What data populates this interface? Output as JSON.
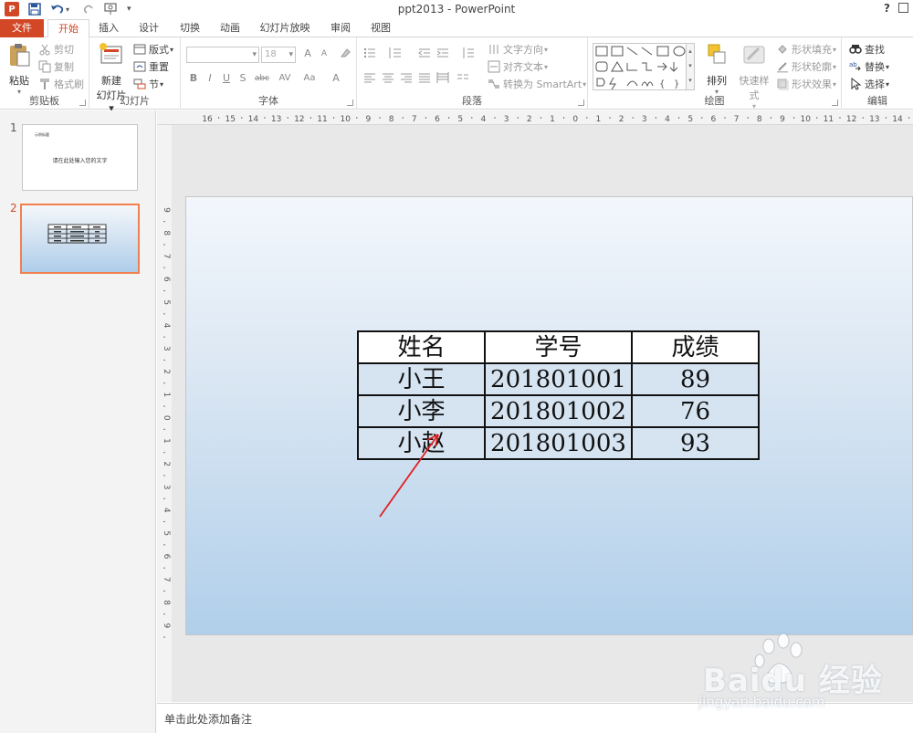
{
  "window": {
    "title": "ppt2013 - PowerPoint",
    "app_logo": "P",
    "help": "?"
  },
  "quick_access": [
    "save-icon",
    "undo-icon",
    "redo-icon",
    "slideshow-icon",
    "customize-icon"
  ],
  "tabs": [
    {
      "label": "文件",
      "kind": "file"
    },
    {
      "label": "开始",
      "kind": "active"
    },
    {
      "label": "插入"
    },
    {
      "label": "设计"
    },
    {
      "label": "切换"
    },
    {
      "label": "动画"
    },
    {
      "label": "幻灯片放映"
    },
    {
      "label": "审阅"
    },
    {
      "label": "视图"
    }
  ],
  "ribbon": {
    "clipboard": {
      "label": "剪贴板",
      "paste": "粘贴",
      "cut": "剪切",
      "copy": "复制",
      "format_painter": "格式刷"
    },
    "slides": {
      "label": "幻灯片",
      "new_slide_1": "新建",
      "new_slide_2": "幻灯片",
      "layout": "版式",
      "reset": "重置",
      "section": "节"
    },
    "font": {
      "label": "字体",
      "font_name": "",
      "font_size": "18",
      "bold": "B",
      "italic": "I",
      "underline": "U",
      "shadow": "S",
      "strike": "abc",
      "spacing": "AV",
      "case": "Aa",
      "color": "A",
      "grow": "A",
      "shrink": "A"
    },
    "paragraph": {
      "label": "段落",
      "text_direction": "文字方向",
      "align_text": "对齐文本",
      "smartart": "转换为 SmartArt"
    },
    "drawing": {
      "label": "绘图",
      "arrange": "排列",
      "quick_styles": "快速样式",
      "shape_fill": "形状填充",
      "shape_outline": "形状轮廓",
      "shape_effects": "形状效果"
    },
    "editing": {
      "label": "编辑",
      "find": "查找",
      "replace": "替换",
      "select": "选择"
    }
  },
  "slides_panel": {
    "slides": [
      {
        "number": "1",
        "title_text": "示例标题",
        "body_text": "请在此处输入您的文字"
      },
      {
        "number": "2",
        "selected": true
      }
    ]
  },
  "slide": {
    "table": {
      "headers": [
        "姓名",
        "学号",
        "成绩"
      ],
      "rows": [
        [
          "小王",
          "201801001",
          "89"
        ],
        [
          "小李",
          "201801002",
          "76"
        ],
        [
          "小赵",
          "201801003",
          "93"
        ]
      ]
    },
    "arrow_color": "#e02020"
  },
  "notes": {
    "placeholder": "单击此处添加备注"
  },
  "watermark": {
    "brand": "Baidu 经验",
    "url": "jingyan.baidu.com"
  },
  "colors": {
    "accent": "#d24726",
    "selected_thumb_border": "#f08050"
  },
  "rulers": {
    "horizontal_labels": [
      "16",
      "15",
      "14",
      "13",
      "12",
      "11",
      "10",
      "9",
      "8",
      "7",
      "6",
      "5",
      "4",
      "3",
      "2",
      "1",
      "0",
      "1",
      "2",
      "3",
      "4",
      "5",
      "6",
      "7",
      "8",
      "9",
      "10",
      "11",
      "12",
      "13",
      "14",
      "15",
      "16"
    ],
    "vertical_labels": [
      "9",
      "8",
      "7",
      "6",
      "5",
      "4",
      "3",
      "2",
      "1",
      "0",
      "1",
      "2",
      "3",
      "4",
      "5",
      "6",
      "7",
      "8",
      "9"
    ]
  }
}
